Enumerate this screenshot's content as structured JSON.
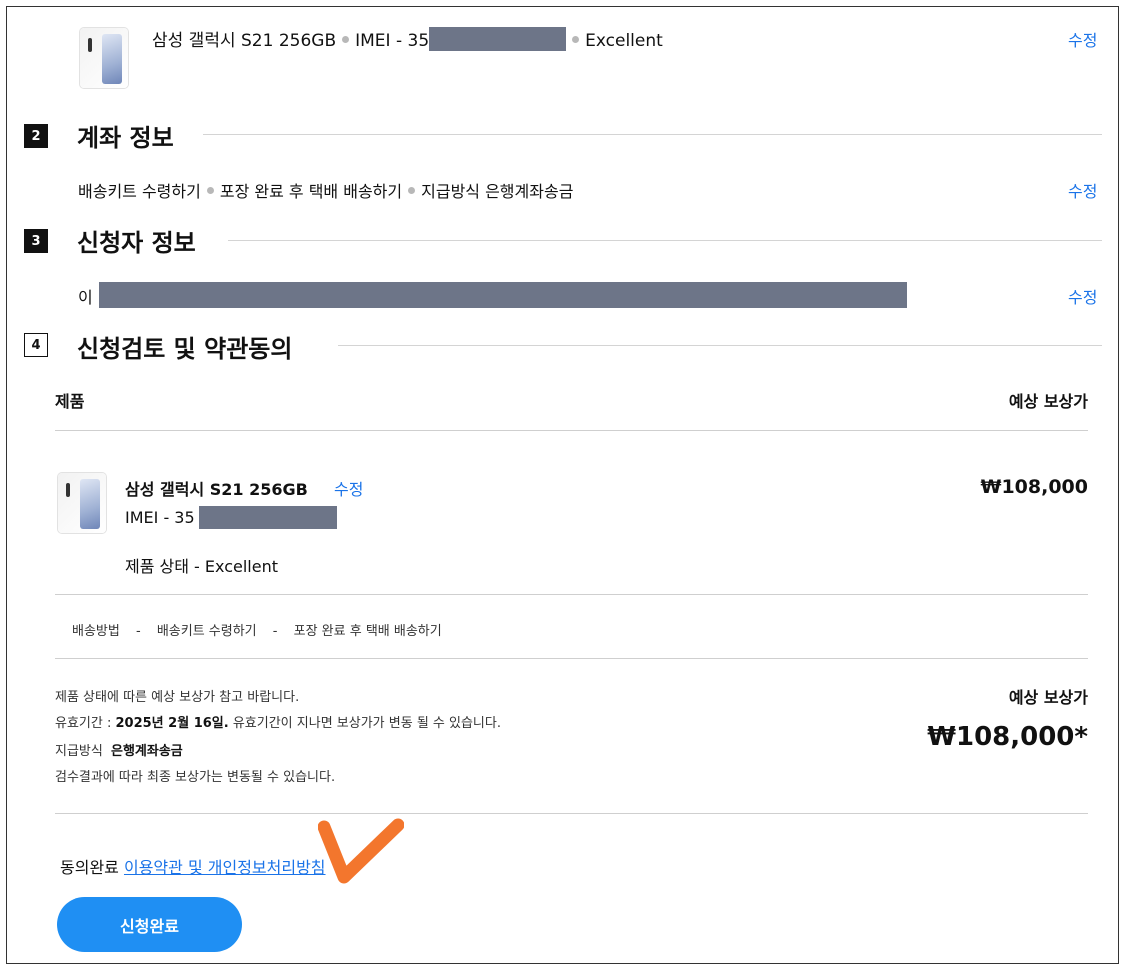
{
  "product_summary": {
    "name": "삼성 갤럭시 S21 256GB",
    "imei_label": "IMEI - 35",
    "condition": "Excellent",
    "edit_label": "수정"
  },
  "sections": [
    {
      "number": "2",
      "title": "계좌 정보",
      "summary_parts": [
        "배송키트 수령하기",
        "포장 완료 후 택배 배송하기",
        "지급방식 은행계좌송금"
      ],
      "edit_label": "수정"
    },
    {
      "number": "3",
      "title": "신청자 정보",
      "summary_prefix": "이",
      "edit_label": "수정"
    },
    {
      "number": "4",
      "title": "신청검토 및 약관동의"
    }
  ],
  "review": {
    "col_product": "제품",
    "col_price": "예상 보상가",
    "item_name": "삼성 갤럭시 S21 256GB",
    "item_edit": "수정",
    "item_imei": "IMEI - 35",
    "item_condition": "제품 상태 - Excellent",
    "item_price": "₩108,000",
    "shipping_label": "배송방법",
    "shipping_sep": "-",
    "shipping_kit": "배송키트 수령하기",
    "shipping_method": "포장 완료 후 택배 배송하기",
    "note1": "제품 상태에 따른 예상 보상가 참고 바랍니다.",
    "validity_label": "유효기간 :",
    "validity_date": "2025년 2월 16일.",
    "validity_note": "유효기간이 지나면 보상가가 변동 될 수 있습니다.",
    "payment_label": "지급방식",
    "payment_value": "은행계좌송금",
    "note2": "검수결과에 따라 최종 보상가는 변동될 수 있습니다.",
    "total_label": "예상 보상가",
    "total_value": "₩108,000*"
  },
  "agreement": {
    "prefix": "동의완료",
    "link": "이용약관 및 개인정보처리방침"
  },
  "submit_label": "신청완료",
  "colors": {
    "link": "#1a73e8",
    "button": "#1f8ff3",
    "redaction": "#6d7588",
    "annotation": "#f26a1b"
  }
}
